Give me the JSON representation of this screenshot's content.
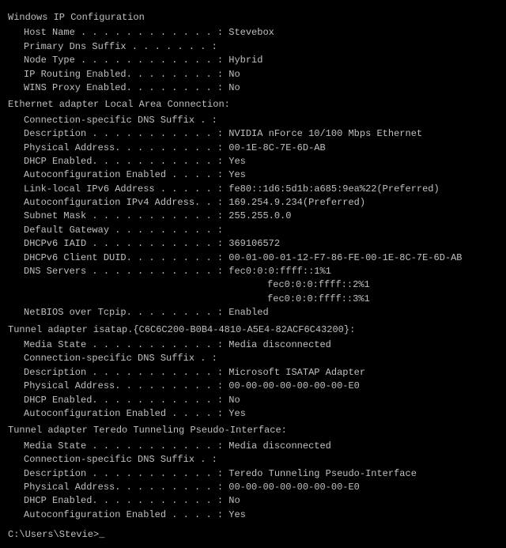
{
  "title": "Windows IP Configuration",
  "sections": {
    "windows_ip": {
      "header": "Windows IP Configuration",
      "fields": [
        {
          "label": "Host Name . . . . . . . . . . . . :",
          "value": "Stevebox"
        },
        {
          "label": "Primary Dns Suffix  . . . . . . . :",
          "value": ""
        },
        {
          "label": "Node Type . . . . . . . . . . . . :",
          "value": "Hybrid"
        },
        {
          "label": "IP Routing Enabled. . . . . . . . :",
          "value": "No"
        },
        {
          "label": "WINS Proxy Enabled. . . . . . . . :",
          "value": "No"
        }
      ]
    },
    "ethernet": {
      "header": "Ethernet adapter Local Area Connection:",
      "fields": [
        {
          "label": "Connection-specific DNS Suffix  . :",
          "value": ""
        },
        {
          "label": "Description . . . . . . . . . . . :",
          "value": "NVIDIA nForce 10/100 Mbps Ethernet"
        },
        {
          "label": "Physical Address. . . . . . . . . :",
          "value": "00-1E-8C-7E-6D-AB"
        },
        {
          "label": "DHCP Enabled. . . . . . . . . . . :",
          "value": "Yes"
        },
        {
          "label": "Autoconfiguration Enabled . . . . :",
          "value": "Yes"
        },
        {
          "label": "Link-local IPv6 Address . . . . . :",
          "value": "fe80::1d6:5d1b:a685:9ea%22(Preferred)"
        },
        {
          "label": "Autoconfiguration IPv4 Address. . :",
          "value": "169.254.9.234(Preferred)"
        },
        {
          "label": "Subnet Mask . . . . . . . . . . . :",
          "value": "255.255.0.0"
        },
        {
          "label": "Default Gateway . . . . . . . . . :",
          "value": ""
        },
        {
          "label": "DHCPv6 IAID . . . . . . . . . . . :",
          "value": "369106572"
        },
        {
          "label": "DHCPv6 Client DUID. . . . . . . . :",
          "value": "00-01-00-01-12-F7-86-FE-00-1E-8C-7E-6D-AB"
        },
        {
          "label": "DNS Servers . . . . . . . . . . . :",
          "value": "fec0:0:0:ffff::1%1"
        },
        {
          "label": "",
          "value": "fec0:0:0:ffff::2%1"
        },
        {
          "label": "",
          "value": "fec0:0:0:ffff::3%1"
        },
        {
          "label": "NetBIOS over Tcpip. . . . . . . . :",
          "value": "Enabled"
        }
      ]
    },
    "tunnel_isatap": {
      "header": "Tunnel adapter isatap.{C6C6C200-B0B4-4810-A5E4-82ACF6C43200}:",
      "fields": [
        {
          "label": "Media State . . . . . . . . . . . :",
          "value": "Media disconnected"
        },
        {
          "label": "Connection-specific DNS Suffix  . :",
          "value": ""
        },
        {
          "label": "Description . . . . . . . . . . . :",
          "value": "Microsoft ISATAP Adapter"
        },
        {
          "label": "Physical Address. . . . . . . . . :",
          "value": "00-00-00-00-00-00-00-E0"
        },
        {
          "label": "DHCP Enabled. . . . . . . . . . . :",
          "value": "No"
        },
        {
          "label": "Autoconfiguration Enabled . . . . :",
          "value": "Yes"
        }
      ]
    },
    "tunnel_teredo": {
      "header": "Tunnel adapter Teredo Tunneling Pseudo-Interface:",
      "fields": [
        {
          "label": "Media State . . . . . . . . . . . :",
          "value": "Media disconnected"
        },
        {
          "label": "Connection-specific DNS Suffix  . :",
          "value": ""
        },
        {
          "label": "Description . . . . . . . . . . . :",
          "value": "Teredo Tunneling Pseudo-Interface"
        },
        {
          "label": "Physical Address. . . . . . . . . :",
          "value": "00-00-00-00-00-00-00-E0"
        },
        {
          "label": "DHCP Enabled. . . . . . . . . . . :",
          "value": "No"
        },
        {
          "label": "Autoconfiguration Enabled . . . . :",
          "value": "Yes"
        }
      ]
    }
  },
  "prompt": "C:\\Users\\Stevie>_"
}
